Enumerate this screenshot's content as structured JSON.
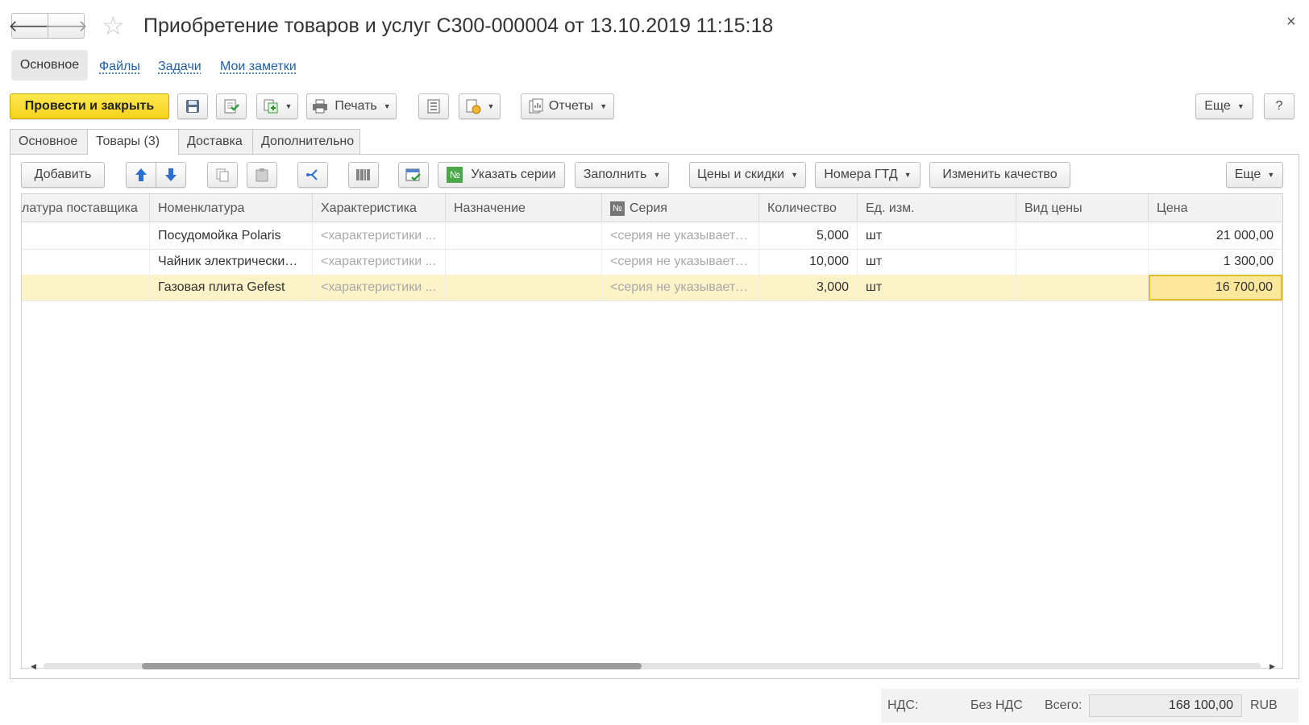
{
  "window": {
    "title": "Приобретение товаров и услуг С300-000004 от 13.10.2019 11:15:18",
    "close_glyph": "×"
  },
  "nav": {
    "back_icon": "arrow-left-icon",
    "forward_icon": "arrow-right-icon"
  },
  "sections": {
    "main": "Основное",
    "links": [
      "Файлы",
      "Задачи",
      "Мои заметки"
    ]
  },
  "toolbar": {
    "post_close": "Провести и закрыть",
    "print": "Печать",
    "reports": "Отчеты",
    "more": "Еще",
    "help": "?"
  },
  "tabs": [
    {
      "label": "Основное",
      "active": false
    },
    {
      "label": "Товары (3)",
      "active": true
    },
    {
      "label": "Доставка",
      "active": false
    },
    {
      "label": "Дополнительно",
      "active": false
    }
  ],
  "table_toolbar": {
    "add": "Добавить",
    "series": "Указать серии",
    "fill": "Заполнить",
    "prices": "Цены и скидки",
    "gtd": "Номера ГТД",
    "quality": "Изменить качество",
    "more": "Еще"
  },
  "table": {
    "columns": [
      "латура поставщика",
      "Номенклатура",
      "Характеристика",
      "Назначение",
      "Серия",
      "Количество",
      "Ед. изм.",
      "Вид цены",
      "Цена"
    ],
    "series_badge": "№",
    "rows": [
      {
        "supplier": "",
        "item": "Посудомойка Polaris",
        "characteristic": "<характеристики ...",
        "purpose": "",
        "series": "<серия не указываетс...",
        "qty": "5,000",
        "unit": "шт",
        "price_type": "",
        "price": "21 000,00"
      },
      {
        "supplier": "",
        "item": "Чайник электрический ...",
        "characteristic": "<характеристики ...",
        "purpose": "",
        "series": "<серия не указываетс...",
        "qty": "10,000",
        "unit": "шт",
        "price_type": "",
        "price": "1 300,00"
      },
      {
        "supplier": "",
        "item": "Газовая плита Gefest",
        "characteristic": "<характеристики ...",
        "purpose": "",
        "series": "<серия не указываетс...",
        "qty": "3,000",
        "unit": "шт",
        "price_type": "",
        "price": "16 700,00"
      }
    ],
    "selected_row": 2
  },
  "footer": {
    "vat_label": "НДС:",
    "vat_value": "Без НДС",
    "total_label": "Всего:",
    "total_value": "168 100,00",
    "currency": "RUB"
  },
  "colors": {
    "primary": "#f6d726",
    "link": "#1f5fa8",
    "selected_row": "#fdf3c9",
    "focus_cell": "#fce79a"
  }
}
